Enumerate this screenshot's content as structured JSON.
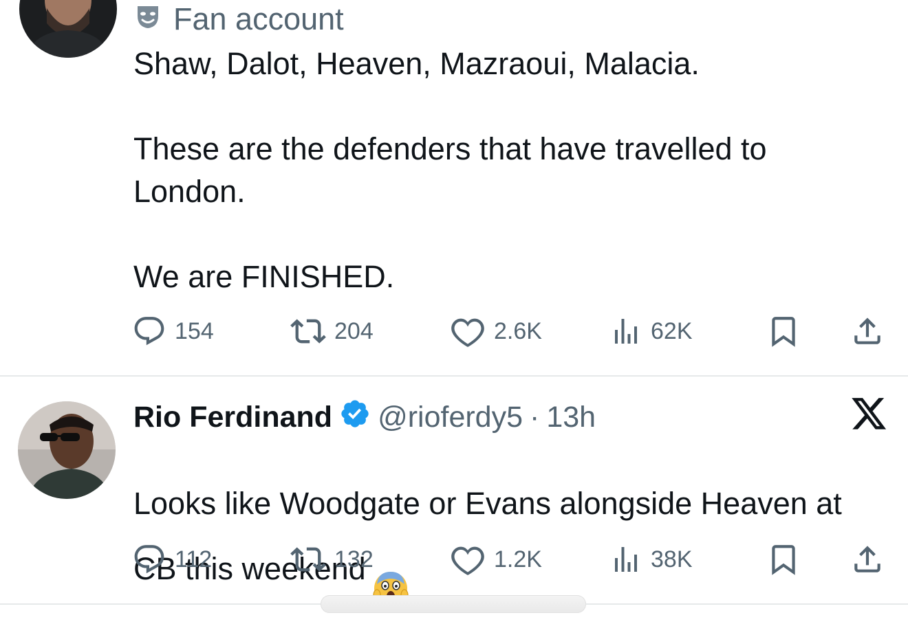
{
  "tweet1": {
    "label": "Fan account",
    "label_icon": "theater-mask-icon",
    "text": "Shaw, Dalot, Heaven, Mazraoui, Malacia.\n\nThese are the defenders that have travelled to\nLondon.\n\nWe are FINISHED.",
    "replies": "154",
    "retweets": "204",
    "likes": "2.6K",
    "views": "62K"
  },
  "tweet2": {
    "name": "Rio Ferdinand",
    "verified": true,
    "handle": "@rioferdy5",
    "separator": "·",
    "time": "13h",
    "text": "Looks like Woodgate or Evans alongside Heaven at\nCB this weekend",
    "emoji": "face-screaming-in-fear",
    "replies": "112",
    "retweets": "132",
    "likes": "1.2K",
    "views": "38K"
  },
  "colors": {
    "text": "#0f1419",
    "secondary": "#536471",
    "verified_badge": "#1d9bf0",
    "divider": "#e6e9ea"
  }
}
